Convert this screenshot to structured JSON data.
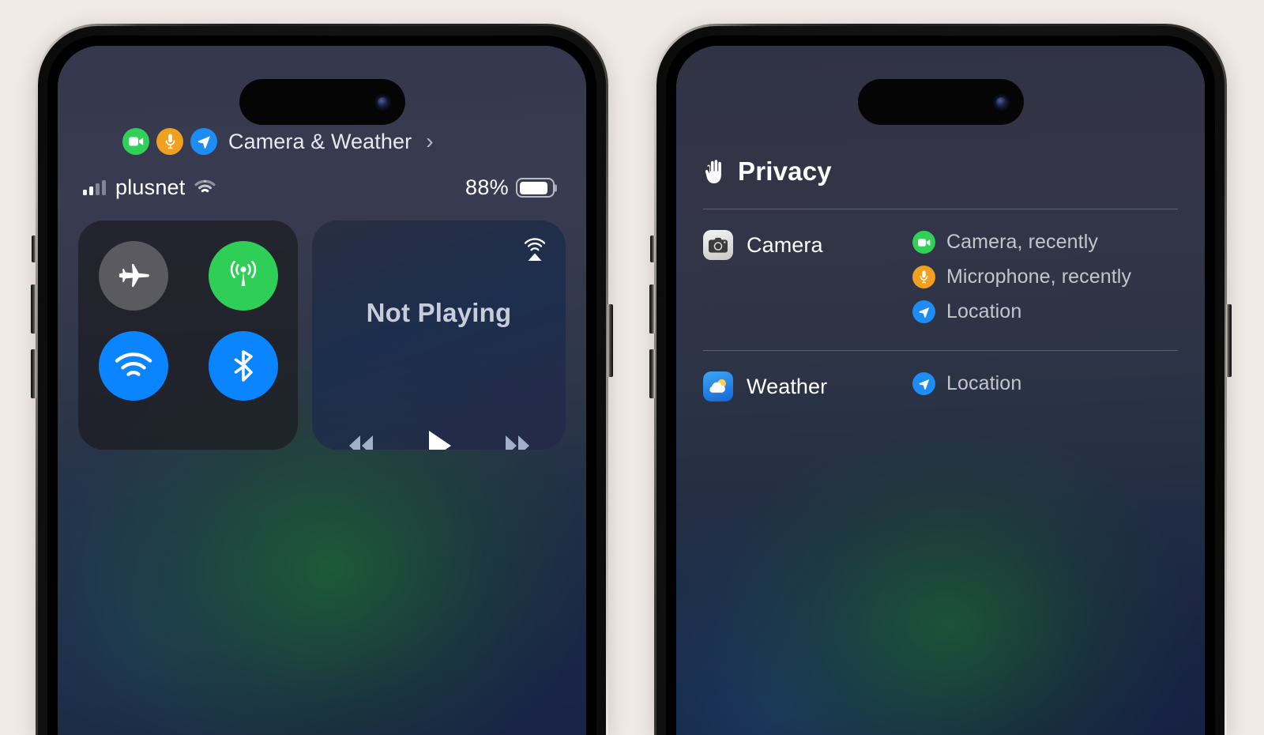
{
  "background_color": "#f2eae7",
  "left_phone": {
    "name": "iphone-control-center",
    "privacy_pill": {
      "indicators": [
        "camera-indicator",
        "microphone-indicator",
        "location-indicator"
      ],
      "label": "Camera & Weather",
      "chevron": "›"
    },
    "status_bar": {
      "signal_bars_filled": 2,
      "signal_bars_total": 4,
      "carrier": "plusnet",
      "wifi_icon": "wifi-icon",
      "battery_percent": "88%",
      "battery_level": 88
    },
    "toggles": [
      {
        "name": "airplane-mode",
        "icon": "airplane-icon",
        "state": "off",
        "color": "#5a5a60"
      },
      {
        "name": "cellular-data",
        "icon": "cellular-icon",
        "state": "on",
        "color": "#2fce56"
      },
      {
        "name": "wifi",
        "icon": "wifi-icon",
        "state": "on",
        "color": "#0a84ff"
      },
      {
        "name": "bluetooth",
        "icon": "bluetooth-icon",
        "state": "on",
        "color": "#0a84ff"
      }
    ],
    "now_playing": {
      "title": "Not Playing",
      "airplay_icon": "airplay-icon",
      "previous_label": "previous-track-icon",
      "play_label": "play-icon",
      "next_label": "next-track-icon"
    }
  },
  "right_phone": {
    "name": "iphone-privacy-report",
    "header": {
      "icon": "raised-hand-icon",
      "title": "Privacy"
    },
    "rows": [
      {
        "app_icon": "camera-app-icon",
        "app_name": "Camera",
        "uses": [
          {
            "indicator": "camera-indicator",
            "color": "#30d158",
            "text": "Camera, recently"
          },
          {
            "indicator": "microphone-indicator",
            "color": "#f0a020",
            "text": "Microphone, recently"
          },
          {
            "indicator": "location-indicator",
            "color": "#1e8cf5",
            "text": "Location"
          }
        ]
      },
      {
        "app_icon": "weather-app-icon",
        "app_name": "Weather",
        "uses": [
          {
            "indicator": "location-indicator",
            "color": "#1e8cf5",
            "text": "Location"
          }
        ]
      }
    ]
  }
}
